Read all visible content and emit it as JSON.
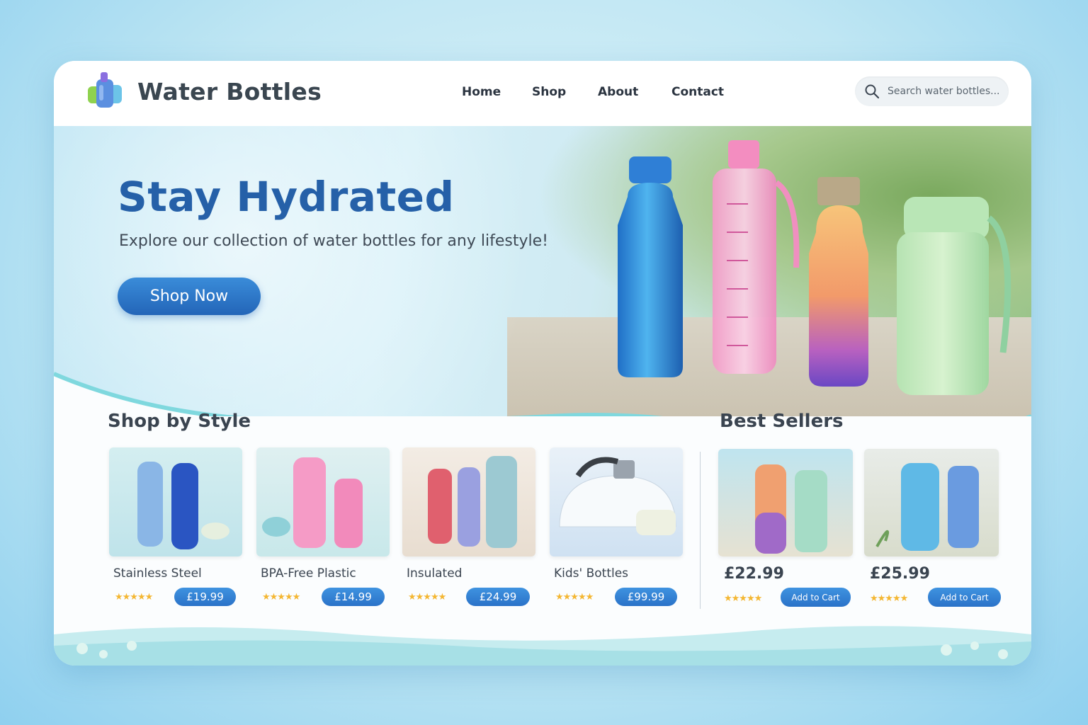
{
  "brand": {
    "name": "Water Bottles",
    "logo_icon": "bottle-logo-icon"
  },
  "nav": {
    "items": [
      {
        "label": "Home"
      },
      {
        "label": "Shop"
      },
      {
        "label": "About"
      },
      {
        "label": "Contact"
      }
    ]
  },
  "search": {
    "placeholder": "Search water bottles...",
    "icon": "search-icon"
  },
  "hero": {
    "title": "Stay Hydrated",
    "subtitle": "Explore our collection of water bottles for any lifestyle!",
    "cta_label": "Shop Now"
  },
  "shop_by_style": {
    "title": "Shop by Style",
    "items": [
      {
        "name": "Stainless Steel",
        "price": "£19.99",
        "rating": 5,
        "stars": "★★★★★"
      },
      {
        "name": "BPA-Free Plastic",
        "price": "£14.99",
        "rating": 5,
        "stars": "★★★★★"
      },
      {
        "name": "Insulated",
        "price": "£24.99",
        "rating": 5,
        "stars": "★★★★★"
      },
      {
        "name": "Kids' Bottles",
        "price": "£99.99",
        "rating": 5,
        "stars": "★★★★★"
      }
    ]
  },
  "best_sellers": {
    "title": "Best Sellers",
    "items": [
      {
        "price": "£22.99",
        "rating": 5,
        "stars": "★★★★★",
        "cart_label": "Add to Cart"
      },
      {
        "price": "£25.99",
        "rating": 5,
        "stars": "★★★★★",
        "cart_label": "Add to Cart"
      }
    ]
  },
  "colors": {
    "primary": "#2560a8",
    "button": "#2a72c8",
    "star": "#f4b733",
    "aqua": "#7fd8de"
  }
}
